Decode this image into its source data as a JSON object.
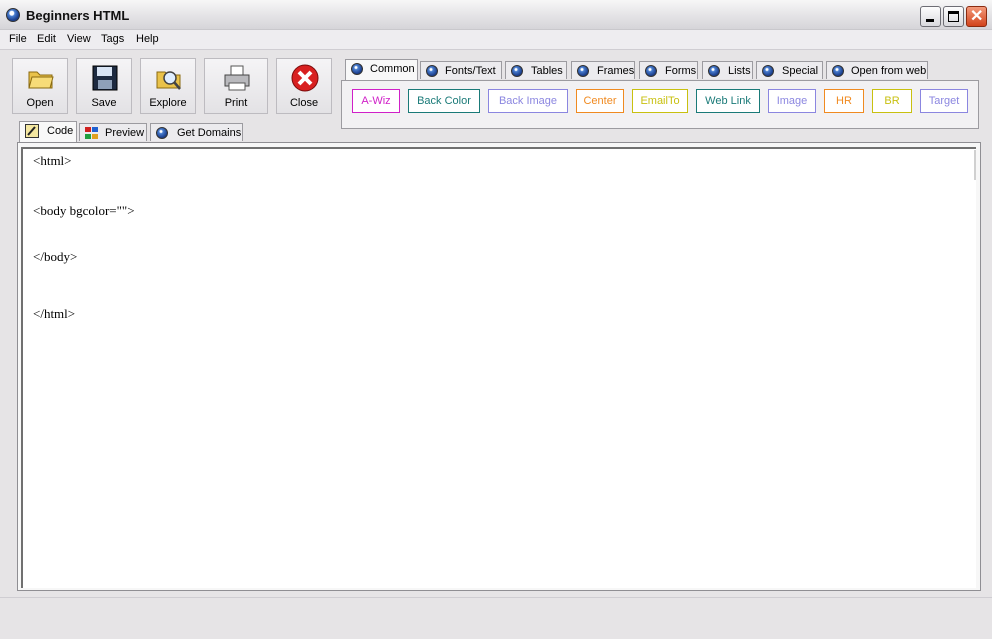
{
  "window": {
    "title": "Beginners HTML"
  },
  "menu": [
    "File",
    "Edit",
    "View",
    "Tags",
    "Help"
  ],
  "toolbar": {
    "open": "Open",
    "save": "Save",
    "explore": "Explore",
    "print": "Print",
    "close": "Close"
  },
  "editor_tabs": [
    "Code",
    "Preview",
    "Get Domains"
  ],
  "tag_tabs": [
    "Common",
    "Fonts/Text",
    "Tables",
    "Frames",
    "Forms",
    "Lists",
    "Special",
    "Open from web"
  ],
  "tag_buttons": [
    {
      "label": "A-Wiz",
      "color": "#d020c8"
    },
    {
      "label": "Back Color",
      "color": "#1a7a78"
    },
    {
      "label": "Back Image",
      "color": "#8b86e0"
    },
    {
      "label": "Center",
      "color": "#f08a20"
    },
    {
      "label": "EmailTo",
      "color": "#c8c010"
    },
    {
      "label": "Web Link",
      "color": "#1a7a78"
    },
    {
      "label": "Image",
      "color": "#8b86e0"
    },
    {
      "label": "HR",
      "color": "#f08a20"
    },
    {
      "label": "BR",
      "color": "#c8c010"
    },
    {
      "label": "Target",
      "color": "#8b86e0"
    }
  ],
  "code": [
    "<html>",
    "<body bgcolor=\"\">",
    "</body>",
    "</html>"
  ]
}
